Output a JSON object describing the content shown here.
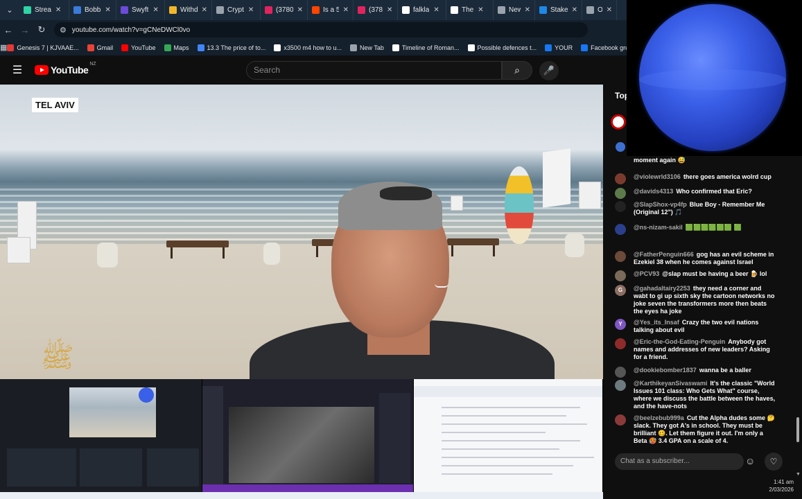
{
  "browser": {
    "tabs": [
      {
        "title": "Strea",
        "color": "#2fd3a5"
      },
      {
        "title": "Bobb",
        "color": "#3b7bd8"
      },
      {
        "title": "Swyft",
        "color": "#6b4bd8"
      },
      {
        "title": "Withd",
        "color": "#f2b62b"
      },
      {
        "title": "Crypt",
        "color": "#9aa3ad"
      },
      {
        "title": "(3780",
        "color": "#e0245e"
      },
      {
        "title": "Is a 5",
        "color": "#ff4500"
      },
      {
        "title": "(378",
        "color": "#e0245e"
      },
      {
        "title": "falkla",
        "color": "#ffffff"
      },
      {
        "title": "The ",
        "color": "#ffffff"
      },
      {
        "title": "New",
        "color": "#9aa3ad"
      },
      {
        "title": "Stake",
        "color": "#1e88e5"
      },
      {
        "title": "Offe",
        "color": "#9aa3ad"
      }
    ],
    "url": "youtube.com/watch?v=gCNeDWCl0vo",
    "bookmarks": [
      {
        "label": "Genesis 7 | KJVAAE...",
        "color": "#e53935"
      },
      {
        "label": "Gmail",
        "color": "#ea4335"
      },
      {
        "label": "YouTube",
        "color": "#ff0000"
      },
      {
        "label": "Maps",
        "color": "#34a853"
      },
      {
        "label": "13.3 The price of to...",
        "color": "#4285f4"
      },
      {
        "label": "x3500 m4 how to u...",
        "color": "#ffffff"
      },
      {
        "label": "New Tab",
        "color": "#9aa3ad"
      },
      {
        "label": "Timeline of Roman...",
        "color": "#ffffff"
      },
      {
        "label": "Possible defences t...",
        "color": "#ffffff"
      },
      {
        "label": "YOUR",
        "color": "#1877f2"
      },
      {
        "label": "Facebook green",
        "color": "#1877f2"
      }
    ]
  },
  "youtube": {
    "logo_word": "YouTube",
    "country_code": "NZ",
    "search_placeholder": "Search"
  },
  "video": {
    "location_caption": "TEL AVIV"
  },
  "chat": {
    "header": "Top",
    "messages": [
      {
        "author": "",
        "text": "moment again 😅",
        "avatar_color": "#3d6fd1",
        "avatar_letter": ""
      },
      {
        "author": "@violewrld3106",
        "text": "there goes america wolrd cup",
        "avatar_color": "#7a3b2e",
        "avatar_letter": ""
      },
      {
        "author": "@davids4313",
        "text": "Who confirmed that Eric?",
        "avatar_color": "#5c7a4a",
        "avatar_letter": ""
      },
      {
        "author": "@SlapShox-vp4fp",
        "text": "Blue Boy - Remember Me (Original 12\") 🎵",
        "avatar_color": "#222222",
        "avatar_letter": ""
      },
      {
        "author": "@ns-nizam-sakil",
        "text": "🟩🟩🟩🟩🟩🟩 🟩",
        "avatar_color": "#2b3f8c",
        "avatar_letter": ""
      },
      {
        "author": "@FatherPenguin666",
        "text": "gog has an evil scheme in Ezekiel 38 when he comes against Israel",
        "avatar_color": "#6b4a3a",
        "avatar_letter": ""
      },
      {
        "author": "@PCV93",
        "text": "@slap must be having a beer 🍺 lol",
        "avatar_color": "#7a6a5a",
        "avatar_letter": ""
      },
      {
        "author": "@gahadaltairy2253",
        "text": "they need a corner and wabt to gi up sixth sky the cartoon networks no joke seven the transformers more then beats the eyes ha joke",
        "avatar_color": "#8d6e63",
        "avatar_letter": "G"
      },
      {
        "author": "@Yes_its_Insaf",
        "text": "Crazy the two evil nations talking about evil",
        "avatar_color": "#7e57c2",
        "avatar_letter": "Y"
      },
      {
        "author": "@Eric-the-God-Eating-Penguin",
        "text": "Anybody got names and addresses of new leaders? Asking for a friend.",
        "avatar_color": "#8e2b2b",
        "avatar_letter": ""
      },
      {
        "author": "@dookiebomber1837",
        "text": "wanna be a baller",
        "avatar_color": "#555555",
        "avatar_letter": ""
      },
      {
        "author": "@KarthikeyanSivaswami",
        "text": "It's the classic \"World Issues 101 class: Who Gets What\" course, where we discuss the battle between the haves, and the have-nots",
        "avatar_color": "#6d7a80",
        "avatar_letter": ""
      },
      {
        "author": "@beelzebub999a",
        "text": "Cut the Alpha dudes some 🤔 slack. They got A's in school. They must be brilliant 🥴. Let them figure it out. I'm only a Beta 🥵 3.4 GPA on a scale of 4.",
        "avatar_color": "#8b3a3a",
        "avatar_letter": ""
      }
    ],
    "input_placeholder": "Chat as a subscriber..."
  },
  "system": {
    "time": "1:41 am",
    "date": "2/03/2026"
  }
}
